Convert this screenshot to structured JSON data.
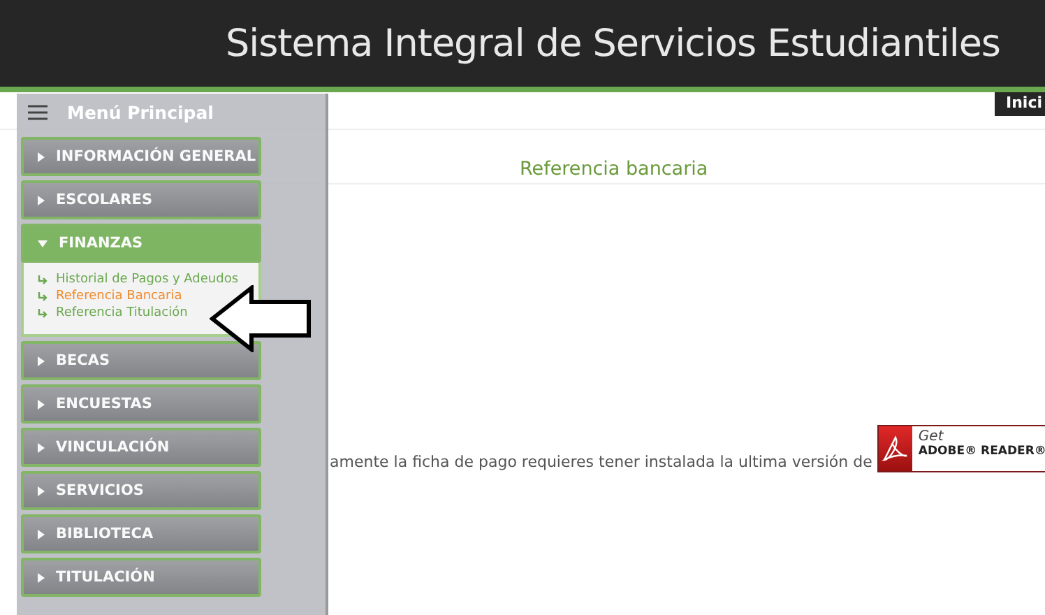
{
  "header": {
    "title": "Sistema Integral de Servicios Estudiantiles",
    "tab": "Inici"
  },
  "menu": {
    "title": "Menú Principal",
    "items": [
      {
        "label": "INFORMACIÓN GENERAL",
        "expanded": false
      },
      {
        "label": "ESCOLARES",
        "expanded": false
      },
      {
        "label": "FINANZAS",
        "expanded": true,
        "children": [
          {
            "label": "Historial de Pagos y Adeudos",
            "selected": false
          },
          {
            "label": "Referencia Bancaria",
            "selected": true
          },
          {
            "label": "Referencia Titulación",
            "selected": false
          }
        ]
      },
      {
        "label": "BECAS",
        "expanded": false
      },
      {
        "label": "ENCUESTAS",
        "expanded": false
      },
      {
        "label": "VINCULACIÓN",
        "expanded": false
      },
      {
        "label": "SERVICIOS",
        "expanded": false
      },
      {
        "label": "BIBLIOTECA",
        "expanded": false
      },
      {
        "label": "TITULACIÓN",
        "expanded": false
      }
    ]
  },
  "content": {
    "heading": "Referencia bancaria",
    "notice": "amente la ficha de pago requieres tener instalada la ultima versión de",
    "badge": {
      "get": "Get",
      "product": "ADOBE® READER®"
    }
  }
}
